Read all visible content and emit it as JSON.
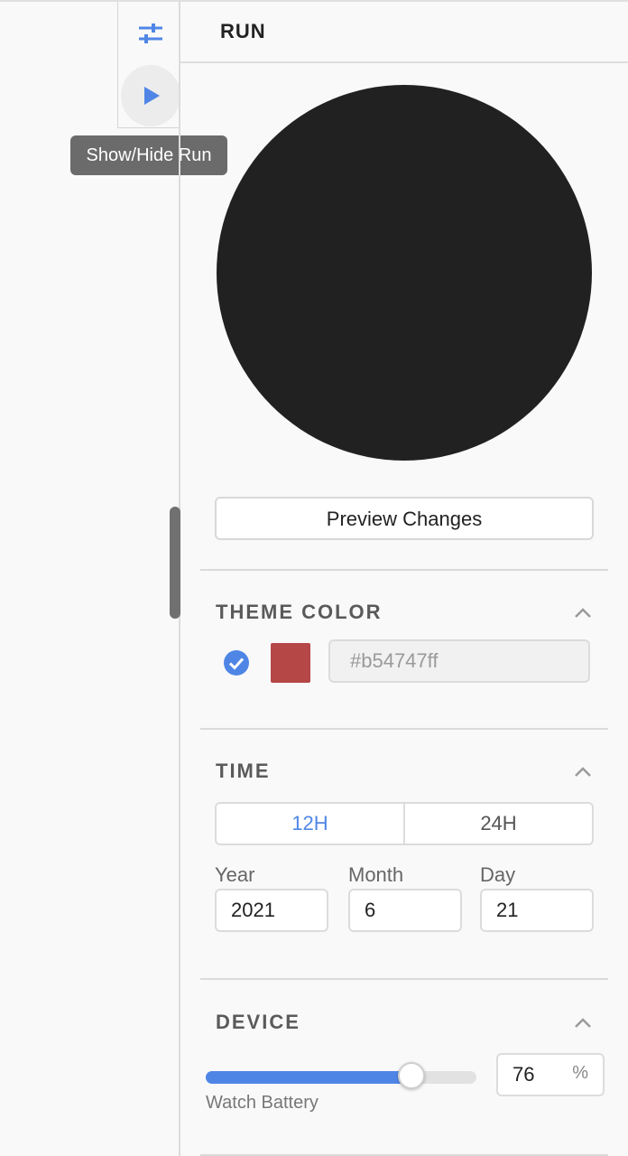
{
  "toolbar": {
    "settings_icon": "sliders-icon",
    "run_icon": "play-icon",
    "tooltip": "Show/Hide Run"
  },
  "panel": {
    "title": "RUN"
  },
  "preview": {
    "button_label": "Preview Changes",
    "watch_color": "#212121"
  },
  "theme_color": {
    "title": "THEME COLOR",
    "checked": true,
    "swatch_color": "#b54747",
    "value": "#b54747ff"
  },
  "time": {
    "title": "TIME",
    "formats": [
      "12H",
      "24H"
    ],
    "selected_format": "12H",
    "year_label": "Year",
    "year": "2021",
    "month_label": "Month",
    "month": "6",
    "day_label": "Day",
    "day": "21"
  },
  "device": {
    "title": "DEVICE",
    "battery_label": "Watch Battery",
    "battery_value": "76",
    "battery_unit": "%",
    "battery_fraction": 0.76
  },
  "colors": {
    "accent": "#4f86e6",
    "separator": "#dadada"
  }
}
